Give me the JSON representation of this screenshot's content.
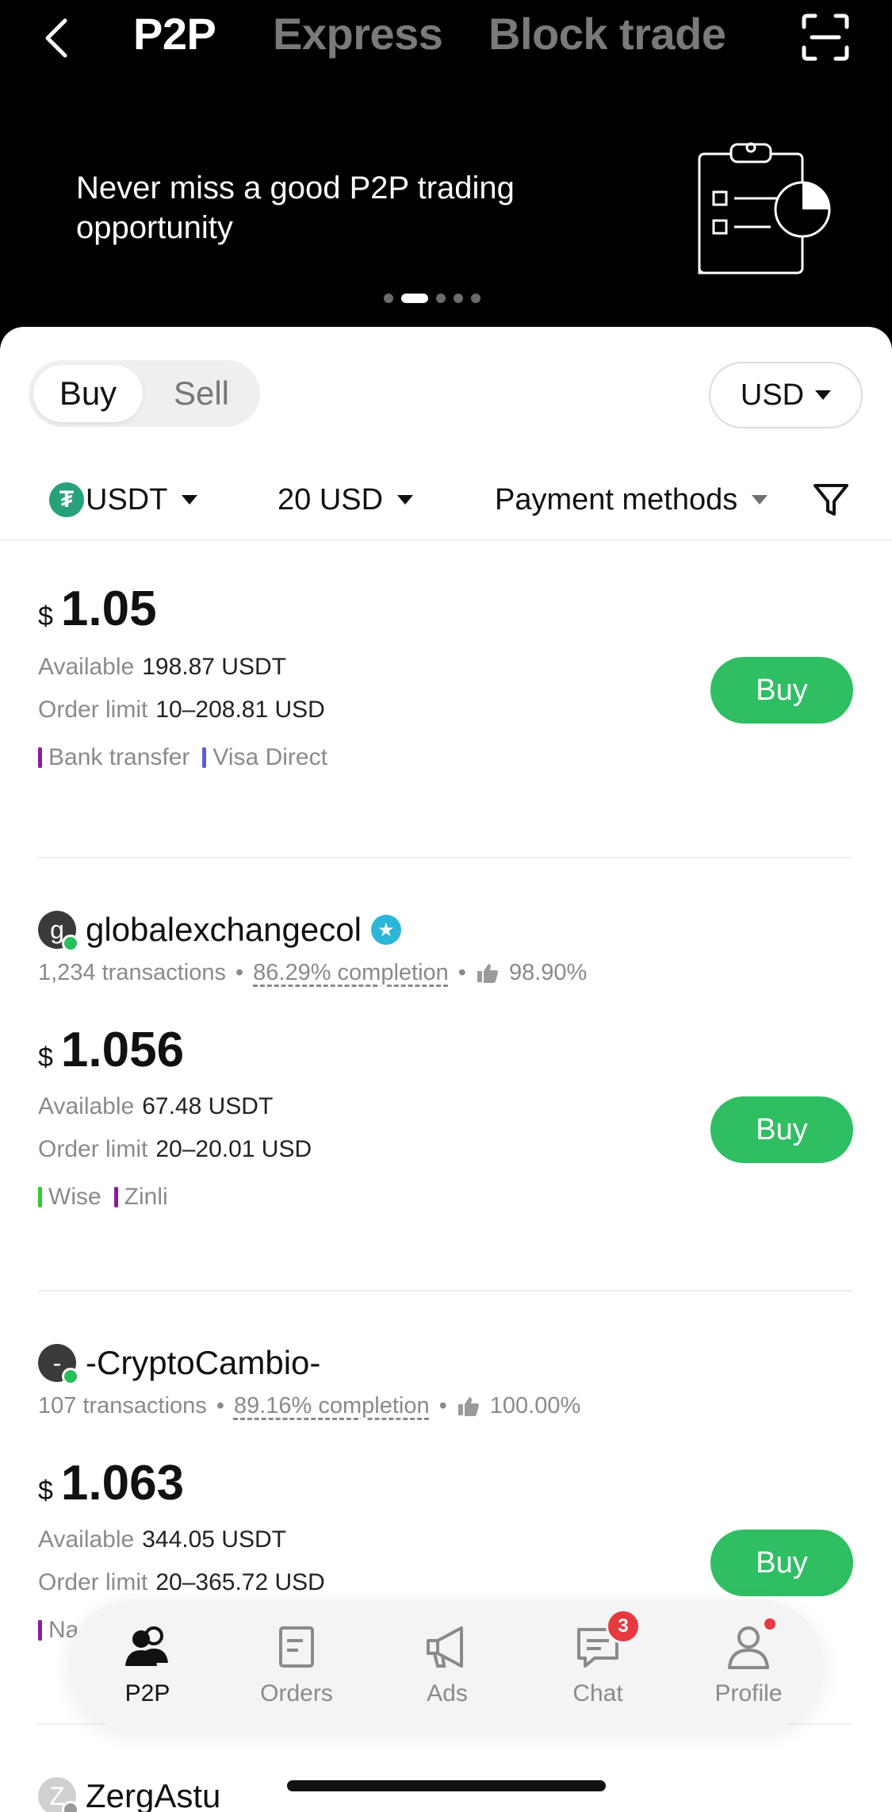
{
  "header": {
    "tabs": [
      {
        "label": "P2P",
        "active": true
      },
      {
        "label": "Express",
        "active": false
      },
      {
        "label": "Block trade",
        "active": false
      }
    ]
  },
  "banner": {
    "text": "Never miss a good P2P trading opportunity",
    "slides_total": 5,
    "active_slide": 2
  },
  "trade_side": {
    "buy_label": "Buy",
    "sell_label": "Sell",
    "selected": "Buy"
  },
  "currency_selector": {
    "value": "USD"
  },
  "filters": {
    "asset": "USDT",
    "asset_icon": "tether-icon",
    "amount": "20 USD",
    "payment": "Payment methods"
  },
  "offers": [
    {
      "price_currency": "$",
      "price": "1.05",
      "available_label": "Available",
      "available": "198.87 USDT",
      "limit_label": "Order limit",
      "limit": "10–208.81 USD",
      "payments": [
        {
          "name": "Bank transfer",
          "color": "#8e1a9e"
        },
        {
          "name": "Visa Direct",
          "color": "#5b5ce6"
        }
      ],
      "action": "Buy"
    },
    {
      "trader": "globalexchangecol",
      "avatar_letter": "g",
      "verified": true,
      "transactions": "1,234 transactions",
      "completion": "86.29% completion",
      "rating": "98.90%",
      "price_currency": "$",
      "price": "1.056",
      "available_label": "Available",
      "available": "67.48 USDT",
      "limit_label": "Order limit",
      "limit": "20–20.01 USD",
      "payments": [
        {
          "name": "Wise",
          "color": "#2ecc2e"
        },
        {
          "name": "Zinli",
          "color": "#8e1a9e"
        }
      ],
      "action": "Buy"
    },
    {
      "trader": "-CryptoCambio-",
      "avatar_letter": "-",
      "transactions": "107 transactions",
      "completion": "89.16% completion",
      "rating": "100.00%",
      "price_currency": "$",
      "price": "1.063",
      "available_label": "Available",
      "available": "344.05 USDT",
      "limit_label": "Order limit",
      "limit": "20–365.72 USD",
      "payments": [
        {
          "name": "Na",
          "color": "#8e1a9e"
        }
      ],
      "action": "Buy"
    },
    {
      "trader": "ZergAstu",
      "avatar_letter": "Z"
    }
  ],
  "bottom_nav": {
    "items": [
      {
        "label": "P2P",
        "icon": "users-icon",
        "active": true
      },
      {
        "label": "Orders",
        "icon": "orders-icon"
      },
      {
        "label": "Ads",
        "icon": "megaphone-icon"
      },
      {
        "label": "Chat",
        "icon": "chat-icon",
        "badge": "3"
      },
      {
        "label": "Profile",
        "icon": "profile-icon",
        "dot": true
      }
    ]
  },
  "colors": {
    "accent_green": "#2fbf62",
    "badge_red": "#e7393f",
    "tether_green": "#26a17b"
  }
}
